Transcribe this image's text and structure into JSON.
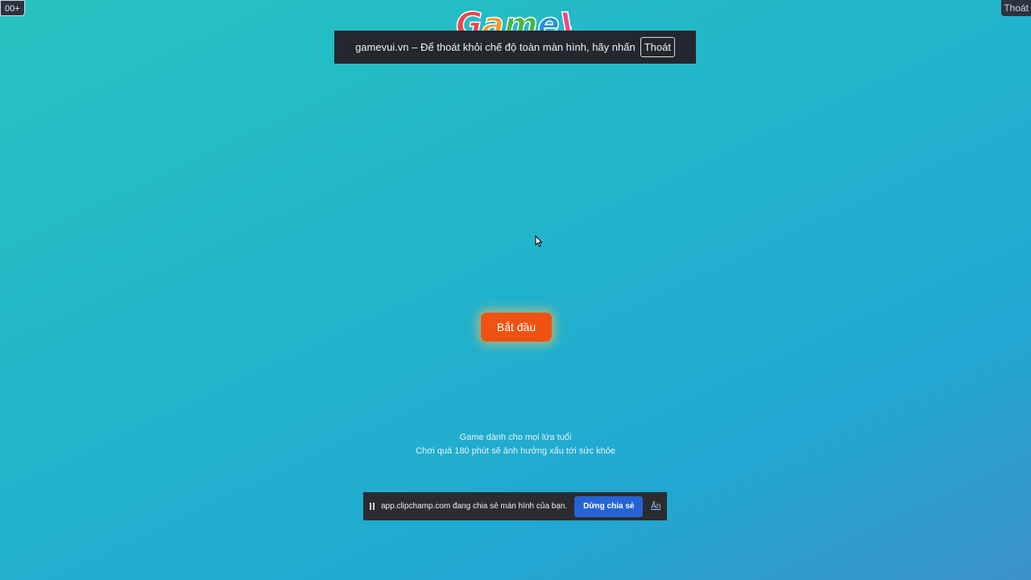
{
  "corner": {
    "age_badge": "00+",
    "exit_label": "Thoát"
  },
  "logo": {
    "text": "GameVui",
    "colors": [
      "#e8474f",
      "#f29a2e",
      "#46b649",
      "#2e8fd8",
      "#e64b8f",
      "#8c4fd0",
      "#e2b21c"
    ]
  },
  "fullscreen_banner": {
    "message": "gamevui.vn – Để thoát khỏi chế độ toàn màn hình, hãy nhấn",
    "exit_button": "Thoát"
  },
  "game": {
    "start_button": "Bắt đầu",
    "start_button_color": "#f05212",
    "age_note_line1": "Game dành cho mọi lứa tuổi",
    "age_note_line2": "Chơi quá 180 phút sẽ ảnh hưởng xấu tới sức khỏe"
  },
  "screen_share": {
    "message": "app.clipchamp.com đang chia sẻ màn hình của bạn.",
    "stop_button": "Dừng chia sẻ",
    "hide_link": "Ẩn"
  },
  "background": {
    "gradient_start": "#27c3c0",
    "gradient_end": "#3c92c8"
  }
}
